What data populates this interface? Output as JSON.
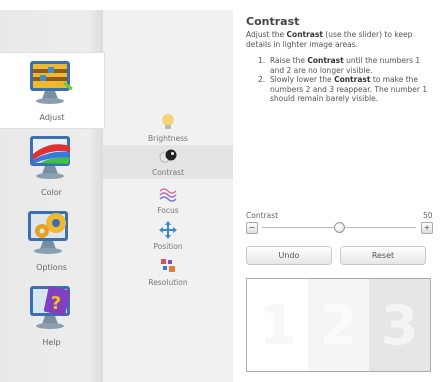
{
  "nav": {
    "items": [
      {
        "label": "Adjust",
        "active": true
      },
      {
        "label": "Color",
        "active": false
      },
      {
        "label": "Options",
        "active": false
      },
      {
        "label": "Help",
        "active": false
      }
    ]
  },
  "submenu": {
    "items": [
      {
        "label": "Brightness",
        "active": false
      },
      {
        "label": "Contrast",
        "active": true
      },
      {
        "label": "Focus",
        "active": false
      },
      {
        "label": "Position",
        "active": false
      },
      {
        "label": "Resolution",
        "active": false
      }
    ]
  },
  "content": {
    "title": "Contrast",
    "intro_pre": "Adjust the ",
    "intro_bold": "Contrast",
    "intro_post": " (use the slider) to keep details in lighter image areas.",
    "steps": [
      {
        "num": "1.",
        "pre": "Raise the ",
        "bold": "Contrast",
        "post": " until the numbers 1 and 2 are no longer visible."
      },
      {
        "num": "2.",
        "pre": "Slowly lower the ",
        "bold": "Contrast",
        "post": " to make the numbers 2 and 3 reappear. The number 1 should remain barely visible."
      }
    ]
  },
  "slider": {
    "label": "Contrast",
    "value": "50",
    "fraction": 0.5,
    "minus_label": "−",
    "plus_label": "+"
  },
  "buttons": {
    "undo": "Undo",
    "reset": "Reset"
  },
  "test_pattern": {
    "numbers": [
      {
        "text": "1",
        "bg": "#ffffff",
        "fg": "#f7f7f7"
      },
      {
        "text": "2",
        "bg": "#f5f5f5",
        "fg": "#fbfbfb"
      },
      {
        "text": "3",
        "bg": "#e6e6e6",
        "fg": "#f4f4f4"
      }
    ]
  }
}
